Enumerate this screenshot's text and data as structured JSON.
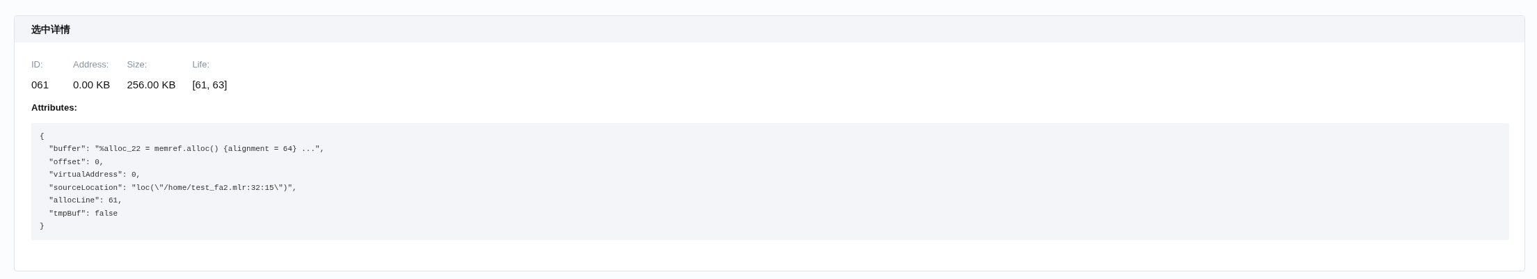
{
  "panel": {
    "title": "选中详情"
  },
  "fields": [
    {
      "label": "ID:",
      "value": "061"
    },
    {
      "label": "Address:",
      "value": "0.00 KB"
    },
    {
      "label": "Size:",
      "value": "256.00 KB"
    },
    {
      "label": "Life:",
      "value": "[61, 63]"
    }
  ],
  "attributes": {
    "heading": "Attributes:",
    "code_lines": [
      "{",
      "  \"buffer\": \"%alloc_22 = memref.alloc() {alignment = 64} ...\",",
      "  \"offset\": 0,",
      "  \"virtualAddress\": 0,",
      "  \"sourceLocation\": \"loc(\\\"/home/test_fa2.mlr:32:15\\\")\",",
      "  \"allocLine\": 61,",
      "  \"tmpBuf\": false",
      "}"
    ]
  }
}
